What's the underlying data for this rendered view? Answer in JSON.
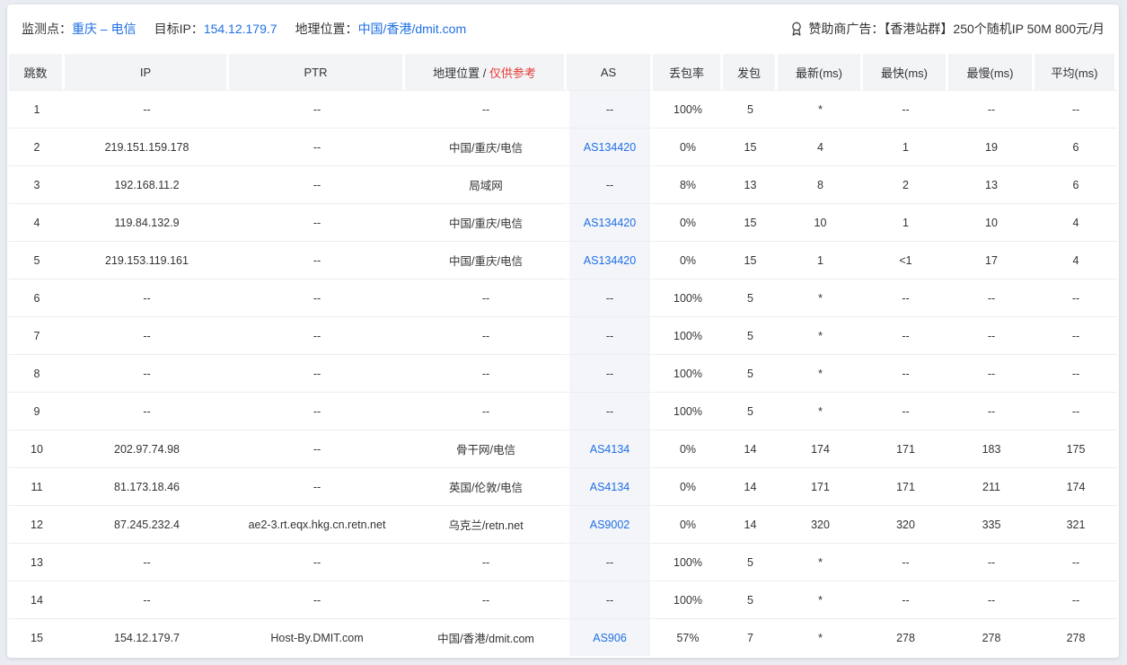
{
  "header": {
    "monitor_label": "监测点：",
    "monitor_value": "重庆 – 电信",
    "target_label": "目标IP：",
    "target_value": "154.12.179.7",
    "geo_label": "地理位置：",
    "geo_value": "中国/香港/dmit.com",
    "sponsor_icon": "award-icon",
    "sponsor_text": "赞助商广告：【香港站群】250个随机IP 50M 800元/月"
  },
  "columns": {
    "hop": "跳数",
    "ip": "IP",
    "ptr": "PTR",
    "geo": "地理位置",
    "geo_sep": " / ",
    "geo_note": "仅供参考",
    "as": "AS",
    "loss": "丢包率",
    "sent": "发包",
    "last": "最新(ms)",
    "best": "最快(ms)",
    "worst": "最慢(ms)",
    "avg": "平均(ms)"
  },
  "rows": [
    {
      "hop": "1",
      "ip": "--",
      "ptr": "--",
      "geo": "--",
      "as": "--",
      "loss": "100%",
      "sent": "5",
      "last": "*",
      "best": "--",
      "worst": "--",
      "avg": "--"
    },
    {
      "hop": "2",
      "ip": "219.151.159.178",
      "ptr": "--",
      "geo": "中国/重庆/电信",
      "as": "AS134420",
      "loss": "0%",
      "sent": "15",
      "last": "4",
      "best": "1",
      "worst": "19",
      "avg": "6"
    },
    {
      "hop": "3",
      "ip": "192.168.11.2",
      "ptr": "--",
      "geo": "局域网",
      "as": "--",
      "loss": "8%",
      "sent": "13",
      "last": "8",
      "best": "2",
      "worst": "13",
      "avg": "6"
    },
    {
      "hop": "4",
      "ip": "119.84.132.9",
      "ptr": "--",
      "geo": "中国/重庆/电信",
      "as": "AS134420",
      "loss": "0%",
      "sent": "15",
      "last": "10",
      "best": "1",
      "worst": "10",
      "avg": "4"
    },
    {
      "hop": "5",
      "ip": "219.153.119.161",
      "ptr": "--",
      "geo": "中国/重庆/电信",
      "as": "AS134420",
      "loss": "0%",
      "sent": "15",
      "last": "1",
      "best": "<1",
      "worst": "17",
      "avg": "4"
    },
    {
      "hop": "6",
      "ip": "--",
      "ptr": "--",
      "geo": "--",
      "as": "--",
      "loss": "100%",
      "sent": "5",
      "last": "*",
      "best": "--",
      "worst": "--",
      "avg": "--"
    },
    {
      "hop": "7",
      "ip": "--",
      "ptr": "--",
      "geo": "--",
      "as": "--",
      "loss": "100%",
      "sent": "5",
      "last": "*",
      "best": "--",
      "worst": "--",
      "avg": "--"
    },
    {
      "hop": "8",
      "ip": "--",
      "ptr": "--",
      "geo": "--",
      "as": "--",
      "loss": "100%",
      "sent": "5",
      "last": "*",
      "best": "--",
      "worst": "--",
      "avg": "--"
    },
    {
      "hop": "9",
      "ip": "--",
      "ptr": "--",
      "geo": "--",
      "as": "--",
      "loss": "100%",
      "sent": "5",
      "last": "*",
      "best": "--",
      "worst": "--",
      "avg": "--"
    },
    {
      "hop": "10",
      "ip": "202.97.74.98",
      "ptr": "--",
      "geo": "骨干网/电信",
      "as": "AS4134",
      "loss": "0%",
      "sent": "14",
      "last": "174",
      "best": "171",
      "worst": "183",
      "avg": "175"
    },
    {
      "hop": "11",
      "ip": "81.173.18.46",
      "ptr": "--",
      "geo": "英国/伦敦/电信",
      "as": "AS4134",
      "loss": "0%",
      "sent": "14",
      "last": "171",
      "best": "171",
      "worst": "211",
      "avg": "174"
    },
    {
      "hop": "12",
      "ip": "87.245.232.4",
      "ptr": "ae2-3.rt.eqx.hkg.cn.retn.net",
      "geo": "乌克兰/retn.net",
      "as": "AS9002",
      "loss": "0%",
      "sent": "14",
      "last": "320",
      "best": "320",
      "worst": "335",
      "avg": "321"
    },
    {
      "hop": "13",
      "ip": "--",
      "ptr": "--",
      "geo": "--",
      "as": "--",
      "loss": "100%",
      "sent": "5",
      "last": "*",
      "best": "--",
      "worst": "--",
      "avg": "--"
    },
    {
      "hop": "14",
      "ip": "--",
      "ptr": "--",
      "geo": "--",
      "as": "--",
      "loss": "100%",
      "sent": "5",
      "last": "*",
      "best": "--",
      "worst": "--",
      "avg": "--"
    },
    {
      "hop": "15",
      "ip": "154.12.179.7",
      "ptr": "Host-By.DMIT.com",
      "geo": "中国/香港/dmit.com",
      "as": "AS906",
      "loss": "57%",
      "sent": "7",
      "last": "*",
      "best": "278",
      "worst": "278",
      "avg": "278"
    }
  ]
}
